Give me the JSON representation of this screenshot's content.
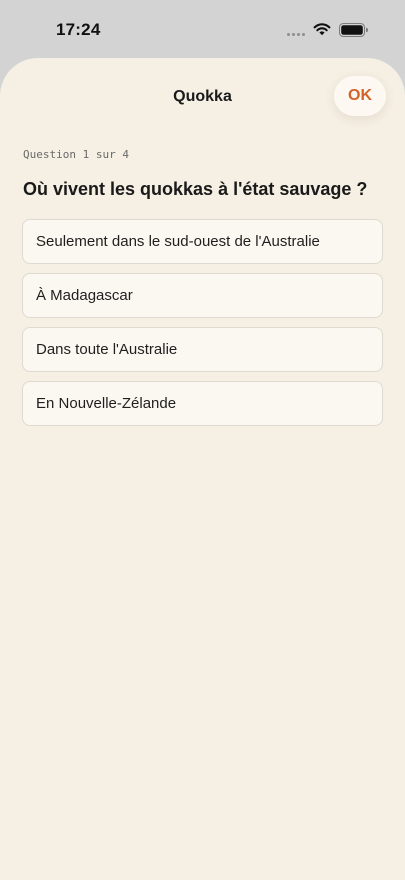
{
  "status_bar": {
    "time": "17:24",
    "icons": [
      "signal-dots-icon",
      "wifi-icon",
      "battery-icon"
    ]
  },
  "sheet": {
    "title": "Quokka",
    "ok_label": "OK"
  },
  "quiz": {
    "counter": "Question 1 sur 4",
    "question": "Où vivent les quokkas à l'état sauvage ?",
    "answers": [
      "Seulement dans le sud-ouest de l'Australie",
      "À Madagascar",
      "Dans toute l'Australie",
      "En Nouvelle-Zélande"
    ]
  },
  "colors": {
    "accent": "#d4622b",
    "sheet_background": "#f5efe4",
    "status_bar_background": "#d3d3d3"
  }
}
